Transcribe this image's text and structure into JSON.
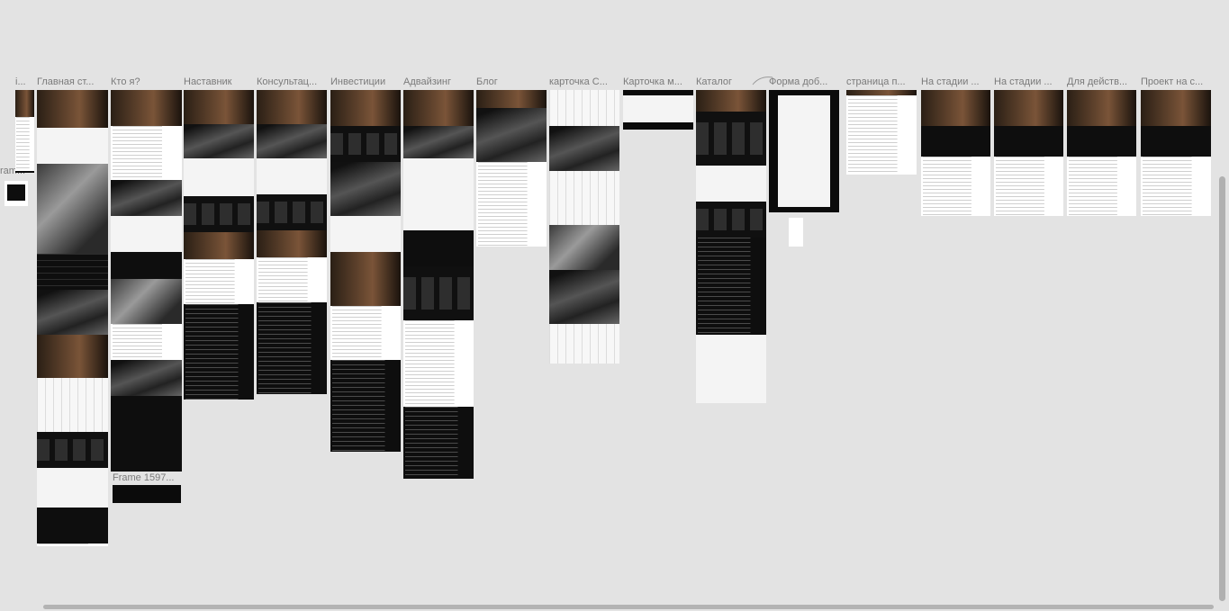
{
  "canvas": {
    "background": "#e3e3e3",
    "labels": [
      "i...",
      "Главная ст...",
      "Кто я?",
      "Наставник",
      "Консультац...",
      "Инвестиции",
      "Адвайзинг",
      "Блог",
      "карточка С...",
      "Карточка м...",
      "Каталог",
      "Форма доб...",
      "страница п...",
      "На стадии ...",
      "На стадии ...",
      "Для действ...",
      "Проект на с..."
    ],
    "extra_labels": {
      "frame_small": "ram...",
      "frame_1597": "Frame 1597..."
    }
  },
  "colors": {
    "frame_dark": "#0b0b0b",
    "accent_gold": "#7a5438",
    "label_text": "#7a7a7a"
  }
}
